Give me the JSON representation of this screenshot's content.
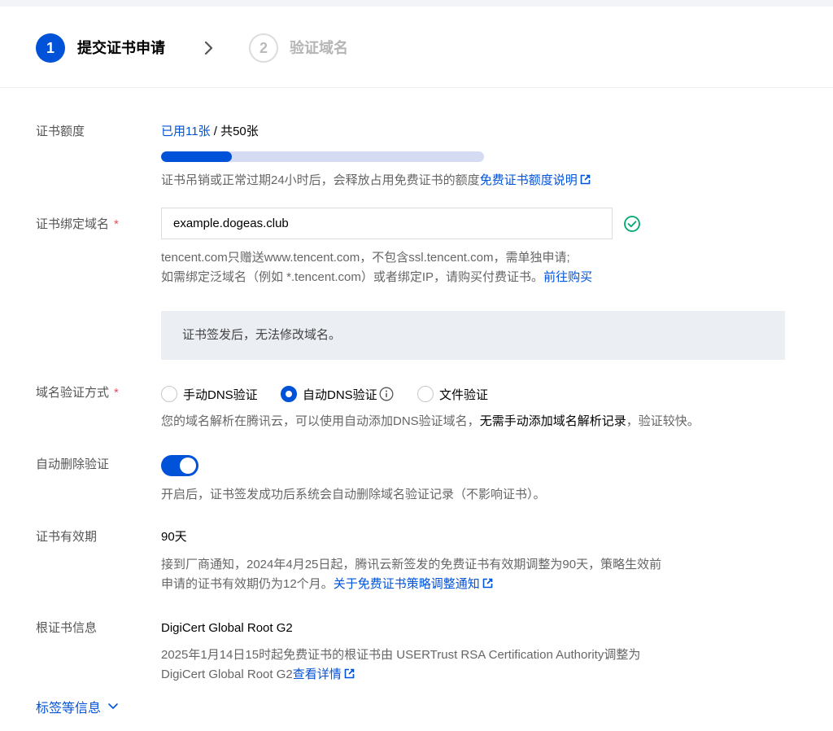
{
  "steps": [
    {
      "number": "1",
      "label": "提交证书申请"
    },
    {
      "number": "2",
      "label": "验证域名"
    }
  ],
  "quota": {
    "label": "证书额度",
    "used": "已用11张",
    "separator": " / ",
    "total": "共50张",
    "progress_percent": 22,
    "help": "证书吊销或正常过期24小时后，会释放占用免费证书的额度",
    "help_link": "免费证书额度说明"
  },
  "domain": {
    "label": "证书绑定域名",
    "required_mark": "*",
    "value": "example.dogeas.club",
    "help_line1": "tencent.com只赠送www.tencent.com，不包含ssl.tencent.com，需单独申请;",
    "help_line2": "如需绑定泛域名（例如 *.tencent.com）或者绑定IP，请购买付费证书。",
    "help_link": "前往购买"
  },
  "notice": "证书签发后，无法修改域名。",
  "verify": {
    "label": "域名验证方式",
    "required_mark": "*",
    "options": [
      "手动DNS验证",
      "自动DNS验证",
      "文件验证"
    ],
    "selected": "自动DNS验证",
    "help_pre": "您的域名解析在腾讯云，可以使用自动添加DNS验证域名，",
    "help_bold": "无需手动添加域名解析记录",
    "help_post": "，验证较快。"
  },
  "auto_delete": {
    "label": "自动删除验证",
    "enabled": true,
    "help": "开启后，证书签发成功后系统会自动删除域名验证记录（不影响证书）。"
  },
  "validity": {
    "label": "证书有效期",
    "value": "90天",
    "help_line1": "接到厂商通知，2024年4月25日起，腾讯云新签发的免费证书有效期调整为90天，策略生效前",
    "help_line2": "申请的证书有效期仍为12个月。",
    "help_link": "关于免费证书策略调整通知"
  },
  "root_cert": {
    "label": "根证书信息",
    "value": "DigiCert Global Root G2",
    "help_line1": "2025年1月14日15时起免费证书的根证书由 USERTrust RSA Certification Authority调整为",
    "help_line2": "DigiCert Global Root G2",
    "help_link": "查看详情"
  },
  "more": "标签等信息",
  "colors": {
    "brand": "#0052d9",
    "success": "#00a870",
    "required": "#e34d59"
  }
}
